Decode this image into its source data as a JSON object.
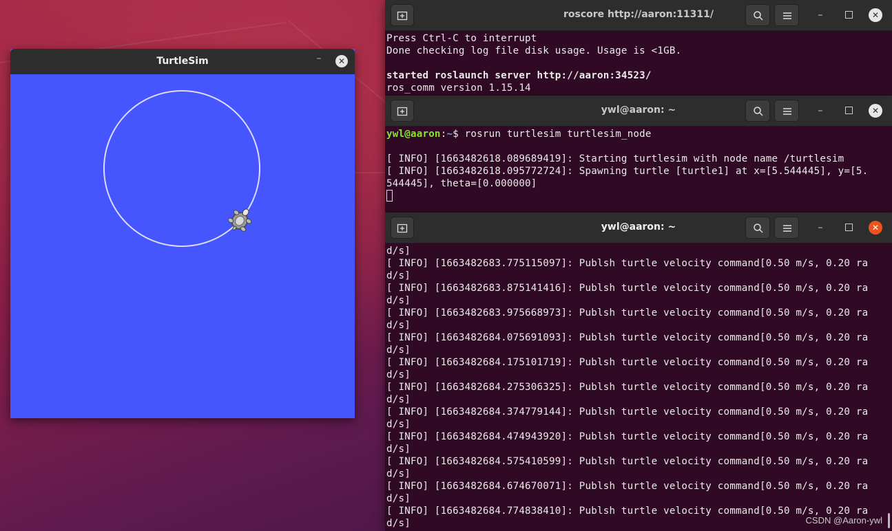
{
  "turtlesim": {
    "title": "TurtleSim",
    "minimize_label": "–",
    "close_label": "✕",
    "background_color": "#4556ff",
    "trail_color": "#d9d9ff"
  },
  "term1": {
    "title": "roscore http://aaron:11311/",
    "lines": [
      "Press Ctrl-C to interrupt",
      "Done checking log file disk usage. Usage is <1GB.",
      "",
      "started roslaunch server http://aaron:34523/",
      "ros_comm version 1.15.14"
    ]
  },
  "term2": {
    "title": "ywl@aaron: ~",
    "prompt_user": "ywl@aaron",
    "prompt_sep": ":",
    "prompt_path": "~",
    "prompt_symbol": "$ ",
    "command": "rosrun turtlesim turtlesim_node",
    "lines": [
      "",
      "[ INFO] [1663482618.089689419]: Starting turtlesim with node name /turtlesim",
      "[ INFO] [1663482618.095772724]: Spawning turtle [turtle1] at x=[5.544445], y=[5.",
      "544445], theta=[0.000000]"
    ]
  },
  "term3": {
    "title": "ywl@aaron: ~",
    "lines": [
      "d/s]",
      "[ INFO] [1663482683.775115097]: Publsh turtle velocity command[0.50 m/s, 0.20 ra",
      "d/s]",
      "[ INFO] [1663482683.875141416]: Publsh turtle velocity command[0.50 m/s, 0.20 ra",
      "d/s]",
      "[ INFO] [1663482683.975668973]: Publsh turtle velocity command[0.50 m/s, 0.20 ra",
      "d/s]",
      "[ INFO] [1663482684.075691093]: Publsh turtle velocity command[0.50 m/s, 0.20 ra",
      "d/s]",
      "[ INFO] [1663482684.175101719]: Publsh turtle velocity command[0.50 m/s, 0.20 ra",
      "d/s]",
      "[ INFO] [1663482684.275306325]: Publsh turtle velocity command[0.50 m/s, 0.20 ra",
      "d/s]",
      "[ INFO] [1663482684.374779144]: Publsh turtle velocity command[0.50 m/s, 0.20 ra",
      "d/s]",
      "[ INFO] [1663482684.474943920]: Publsh turtle velocity command[0.50 m/s, 0.20 ra",
      "d/s]",
      "[ INFO] [1663482684.575410599]: Publsh turtle velocity command[0.50 m/s, 0.20 ra",
      "d/s]",
      "[ INFO] [1663482684.674670071]: Publsh turtle velocity command[0.50 m/s, 0.20 ra",
      "d/s]",
      "[ INFO] [1663482684.774838410]: Publsh turtle velocity command[0.50 m/s, 0.20 ra",
      "d/s]"
    ]
  },
  "watermark": "CSDN @Aaron-ywl",
  "colors": {
    "terminal_bg": "#300a24",
    "titlebar_bg": "#2d2d2d",
    "prompt_green": "#8ae234",
    "prompt_blue": "#729fcf",
    "active_close": "#e95420"
  }
}
